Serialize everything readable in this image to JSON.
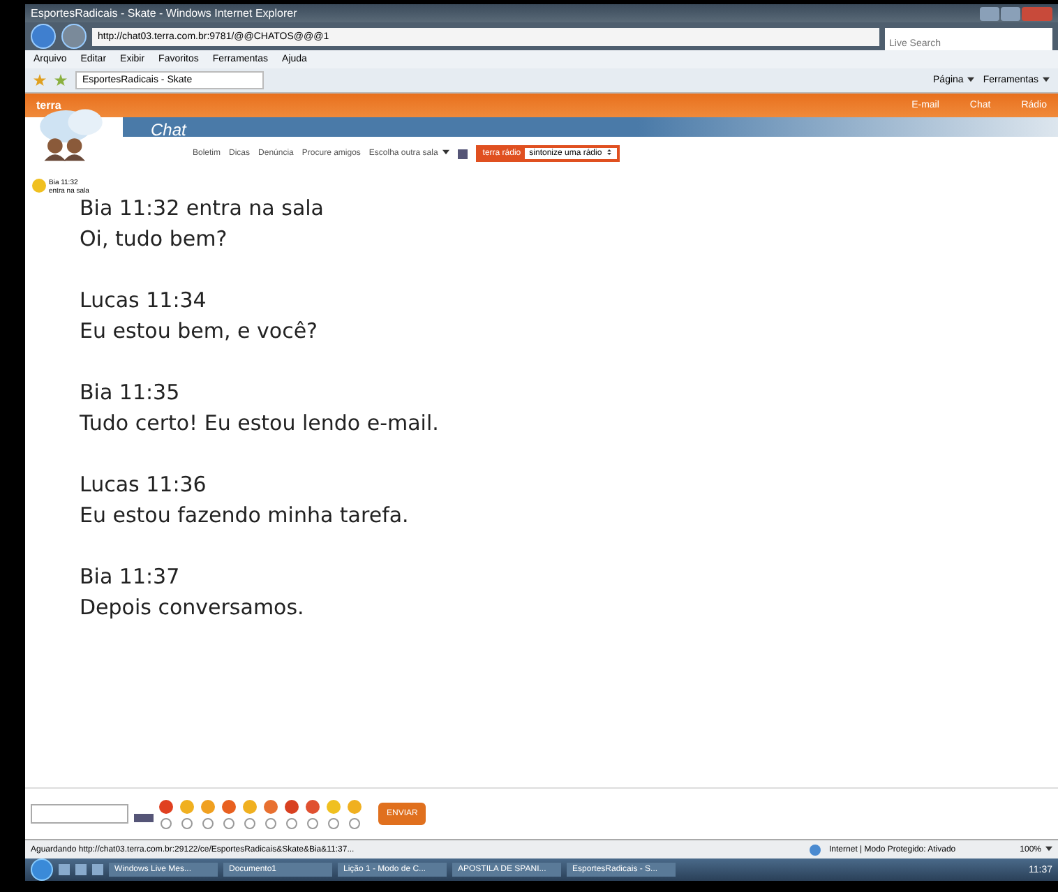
{
  "window": {
    "title": "EsportesRadicais - Skate - Windows Internet Explorer"
  },
  "address_bar": {
    "url": "http://chat03.terra.com.br:9781/@@CHATOS@@@1",
    "search_placeholder": "Live Search"
  },
  "menu": [
    "Arquivo",
    "Editar",
    "Exibir",
    "Favoritos",
    "Ferramentas",
    "Ajuda"
  ],
  "tab": {
    "label": "EsportesRadicais - Skate"
  },
  "command_bar": [
    "Página",
    "Ferramentas"
  ],
  "site_header": {
    "logo": "terra",
    "links": [
      "E-mail",
      "Chat",
      "Rádio"
    ]
  },
  "chat_header": {
    "title": "Chat",
    "nav": [
      "Boletim",
      "Dicas",
      "Denúncia",
      "Procure amigos"
    ],
    "room_select": "Escolha outra sala",
    "radio_label": "terra rádio",
    "radio_select": "sintonize uma rádio"
  },
  "users": [
    {
      "name": "Bia 11:32",
      "note": "entra na sala"
    }
  ],
  "messages": [
    {
      "header": "Bia 11:32 entra na sala",
      "text": "Oi, tudo bem?"
    },
    {
      "header": "Lucas 11:34",
      "text": "Eu estou bem, e você?"
    },
    {
      "header": "Bia 11:35",
      "text": "Tudo certo! Eu estou lendo e-mail."
    },
    {
      "header": "Lucas 11:36",
      "text": "Eu estou fazendo minha tarefa."
    },
    {
      "header": "Bia 11:37",
      "text": "Depois conversamos."
    }
  ],
  "composer": {
    "send": "ENVIAR",
    "emoticon_options": [
      {
        "selected": false
      },
      {
        "selected": false
      },
      {
        "selected": false
      },
      {
        "selected": false
      },
      {
        "selected": false
      },
      {
        "selected": false
      },
      {
        "selected": false
      },
      {
        "selected": false
      },
      {
        "selected": false
      },
      {
        "selected": false
      }
    ]
  },
  "status_bar": {
    "text": "Aguardando http://chat03.terra.com.br:29122/ce/EsportesRadicais&Skate&Bia&11:37...",
    "zone": "Internet | Modo Protegido: Ativado",
    "zoom": "100%"
  },
  "taskbar": {
    "items": [
      "Windows Live Mes...",
      "Documento1",
      "Lição 1 - Modo de C...",
      "APOSTILA DE SPANI...",
      "EsportesRadicais - S..."
    ],
    "clock": "11:37"
  }
}
